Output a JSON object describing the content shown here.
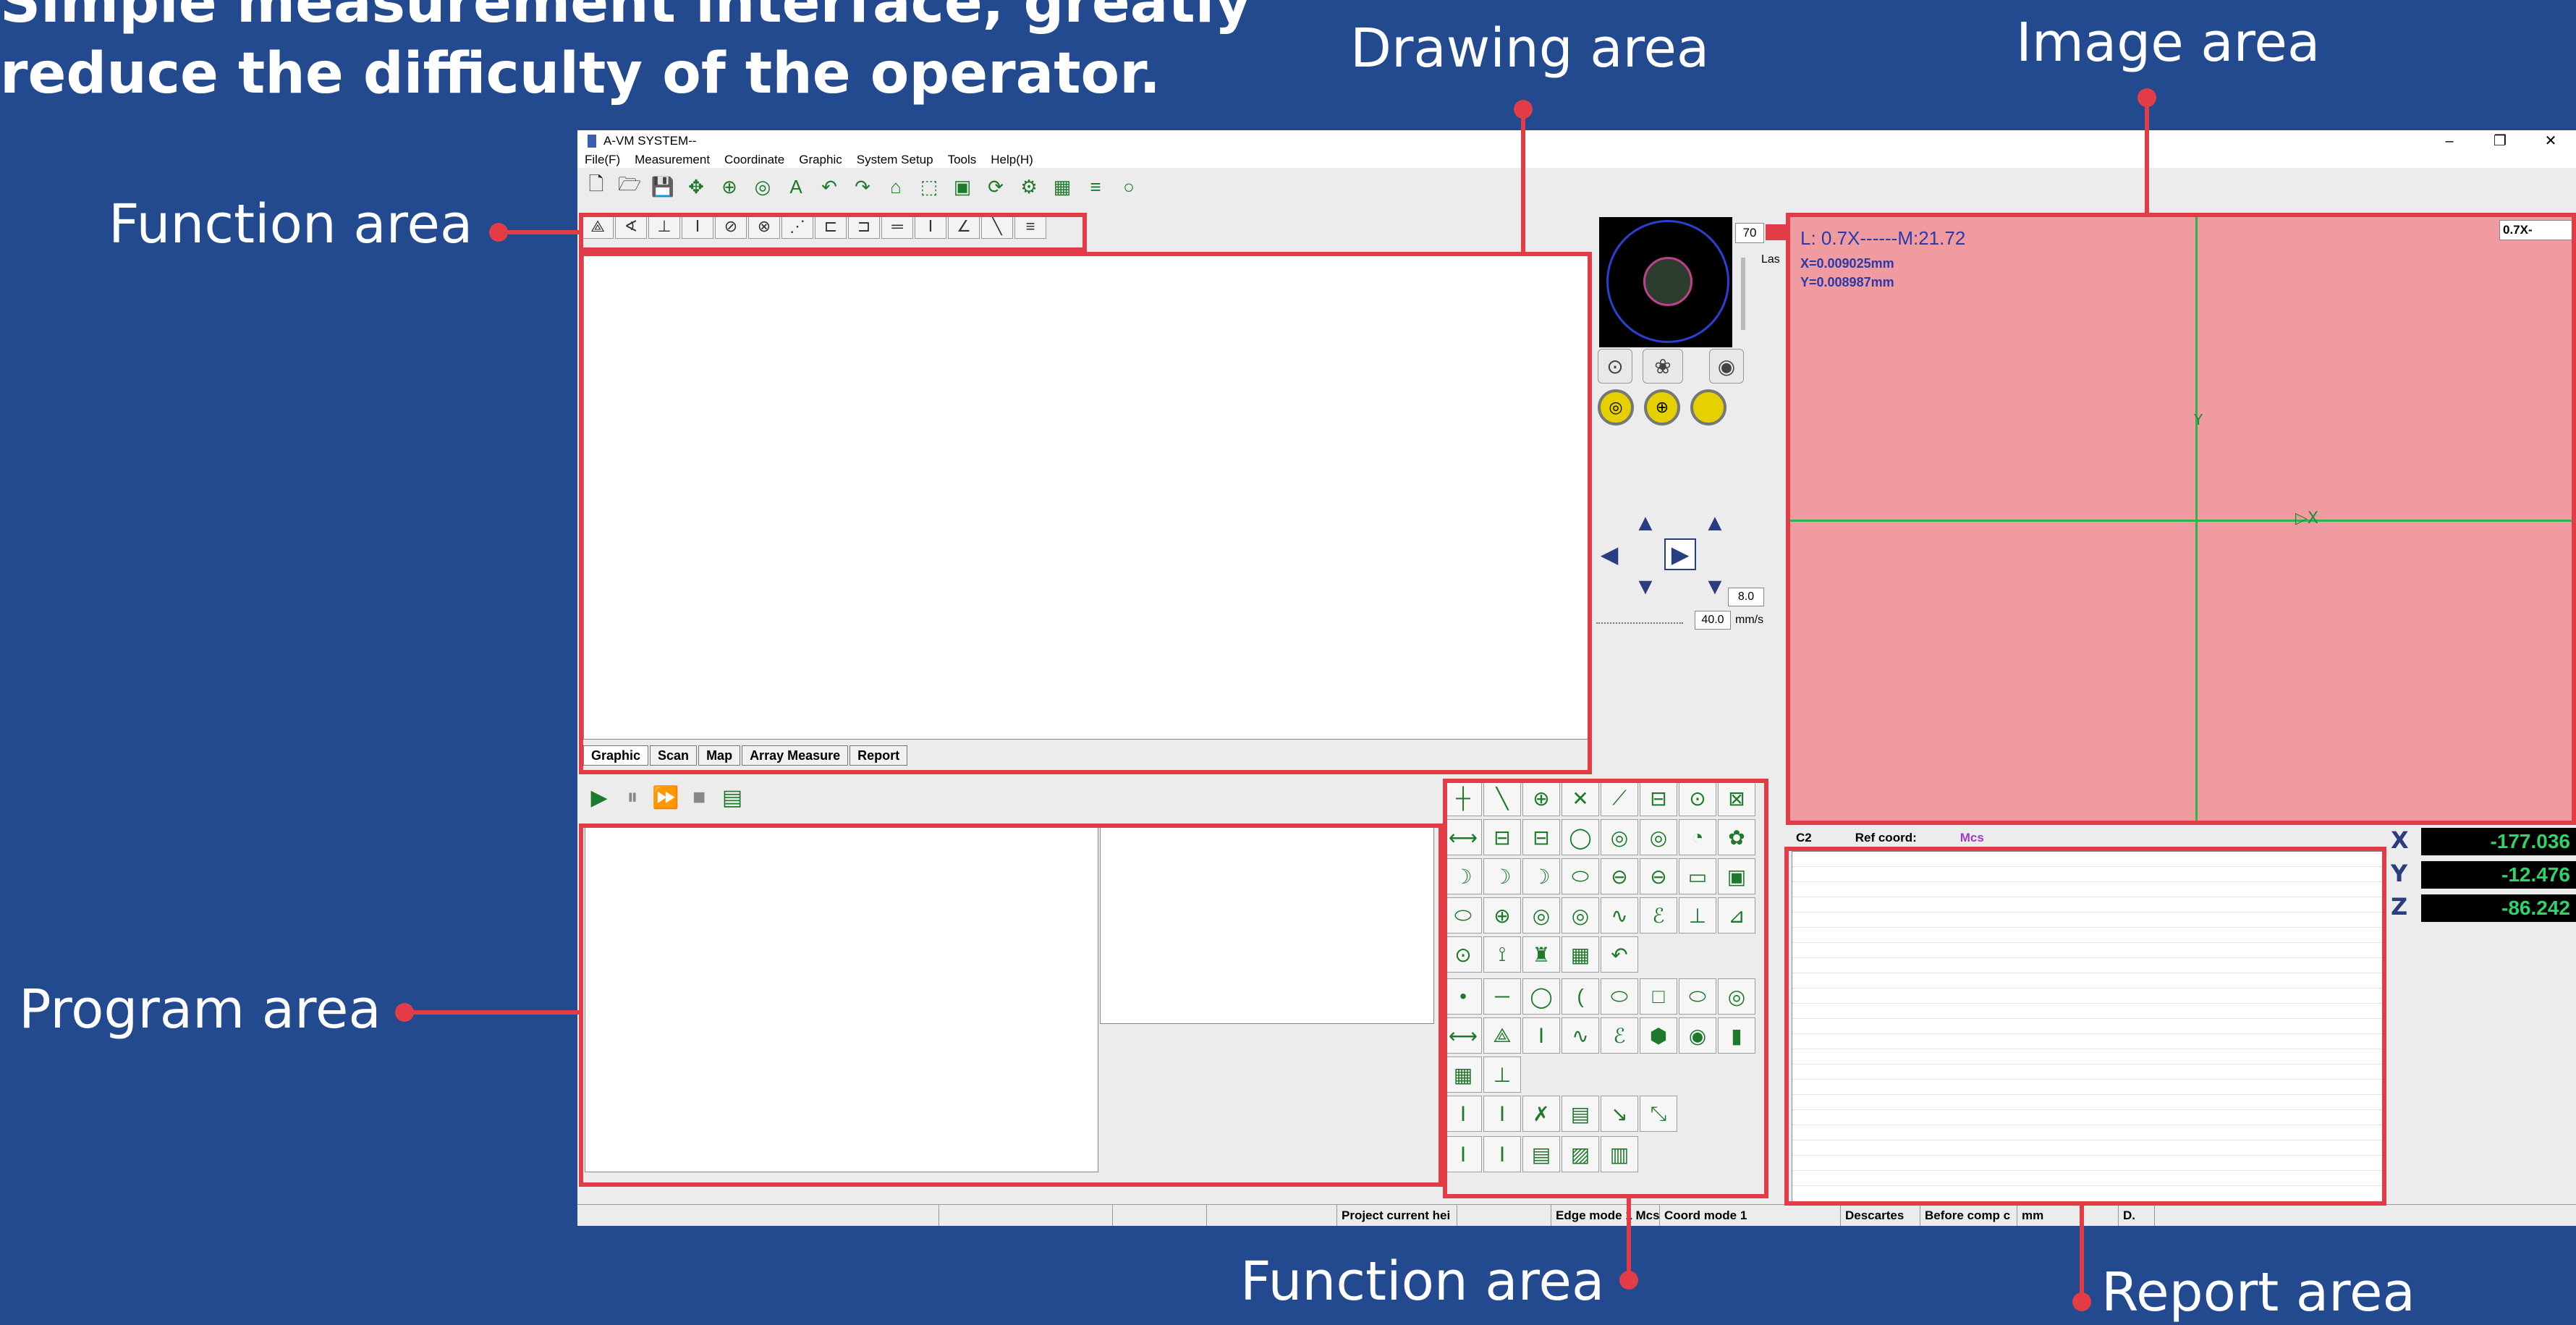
{
  "headline": {
    "line1": "Simple measurement interface, greatly",
    "line2": "reduce the difficulty of the operator."
  },
  "callouts": {
    "drawing_area": "Drawing area",
    "image_area": "Image area",
    "function_area_top": "Function area",
    "program_area": "Program area",
    "function_area_bottom": "Function area",
    "report_area": "Report area"
  },
  "window": {
    "title": "A-VM SYSTEM--",
    "controls": [
      "–",
      "❐",
      "✕"
    ]
  },
  "menu": [
    "File(F)",
    "Measurement",
    "Coordinate",
    "Graphic",
    "System Setup",
    "Tools",
    "Help(H)"
  ],
  "toolbar_icons": [
    {
      "name": "new-file-icon",
      "glyph": "🗋"
    },
    {
      "name": "open-folder-icon",
      "glyph": "🗁"
    },
    {
      "name": "save-icon",
      "glyph": "💾"
    },
    {
      "name": "move-icon",
      "glyph": "✥"
    },
    {
      "name": "zoom-icon",
      "glyph": "⊕"
    },
    {
      "name": "target-icon",
      "glyph": "◎"
    },
    {
      "name": "text-icon",
      "glyph": "A"
    },
    {
      "name": "undo-icon",
      "glyph": "↶"
    },
    {
      "name": "redo-icon",
      "glyph": "↷"
    },
    {
      "name": "home-icon",
      "glyph": "⌂"
    },
    {
      "name": "select-region-icon",
      "glyph": "⬚"
    },
    {
      "name": "image-icon",
      "glyph": "▣"
    },
    {
      "name": "refresh-icon",
      "glyph": "⟳"
    },
    {
      "name": "settings-gear-icon",
      "glyph": "⚙"
    },
    {
      "name": "grid-icon",
      "glyph": "▦"
    },
    {
      "name": "list-icon",
      "glyph": "≡"
    },
    {
      "name": "ring-icon",
      "glyph": "○"
    }
  ],
  "function_tools": [
    "⟁",
    "∢",
    "⊥",
    "Ⅰ",
    "⊘",
    "⊗",
    "⋰",
    "⊏",
    "⊐",
    "═",
    "Ⅰ",
    "∠",
    "╲",
    "≡"
  ],
  "drawing_tabs": [
    "Graphic",
    "Scan",
    "Map",
    "Array Measure",
    "Report"
  ],
  "run_controls": [
    {
      "name": "play-icon",
      "glyph": "▶"
    },
    {
      "name": "pause-icon",
      "glyph": "⏸"
    },
    {
      "name": "step-icon",
      "glyph": "⏩"
    },
    {
      "name": "stop-icon",
      "glyph": "■"
    },
    {
      "name": "export-excel-icon",
      "glyph": "▤"
    }
  ],
  "camera": {
    "magnification": "70",
    "label": "Las"
  },
  "joystick": {
    "step_value": "8.0",
    "speed_value": "40.0",
    "speed_unit": "mm/s"
  },
  "image": {
    "lens_text": "L: 0.7X------M:21.72",
    "x_offset": "X=0.009025mm",
    "y_offset": "Y=0.008987mm",
    "zoom": "0.7X-",
    "axis_y": "Y",
    "axis_x": "X"
  },
  "report": {
    "element": "C2",
    "ref_label": "Ref coord:",
    "ref_value": "Mcs",
    "row_count": 22
  },
  "coords": [
    {
      "axis": "X",
      "value": "-177.036"
    },
    {
      "axis": "Y",
      "value": "-12.476"
    },
    {
      "axis": "Z",
      "value": "-86.242"
    }
  ],
  "status": [
    "",
    "",
    "",
    "",
    "Project current hei",
    "",
    "Edge mode 1 Mcs",
    "Coord mode 1",
    "Descartes",
    "Before comp c",
    "mm",
    "D."
  ],
  "func_rows": [
    [
      "┼",
      "╲",
      "⊕",
      "✕",
      "⟋",
      "⊟",
      "⊙",
      "⊠"
    ],
    [
      "⟷",
      "⊟",
      "⊟",
      "◯",
      "◎",
      "◎",
      "◔",
      "✿"
    ],
    [
      "☽",
      "☽",
      "☽",
      "⬭",
      "⊖",
      "⊖",
      "▭",
      "▣"
    ],
    [
      "⬭",
      "⊕",
      "◎",
      "◎",
      "∿",
      "ℰ",
      "⊥",
      "⊿"
    ],
    [
      "⊙",
      "⟟",
      "♜",
      "▦",
      "↶"
    ],
    [
      "•",
      "─",
      "◯",
      "(",
      "⬭",
      "□",
      "⬭",
      "◎"
    ],
    [
      "⟷",
      "⟁",
      "Ⅰ",
      "∿",
      "ℰ",
      "⬢",
      "◉",
      "▮"
    ],
    [
      "▦",
      "⊥"
    ],
    [
      "Ⅰ",
      "Ⅰ",
      "✗",
      "▤",
      "↘",
      "⤡"
    ],
    [
      "Ⅰ",
      "Ⅰ",
      "▤",
      "▨",
      "▥"
    ]
  ]
}
